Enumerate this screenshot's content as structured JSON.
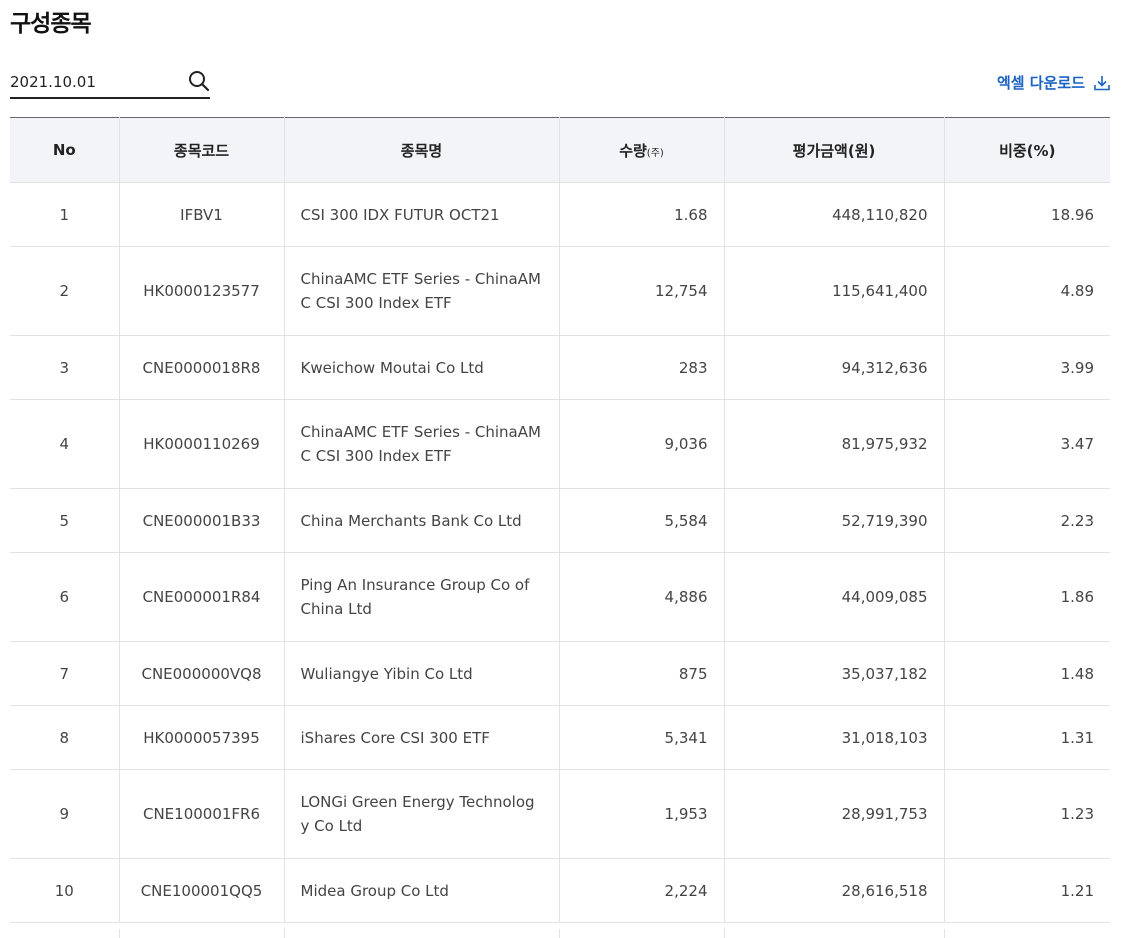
{
  "page_title": "구성종목",
  "search": {
    "date_value": "2021.10.01"
  },
  "download": {
    "label": "엑셀 다운로드"
  },
  "table": {
    "headers": {
      "no": "No",
      "code": "종목코드",
      "name": "종목명",
      "quantity": "수량",
      "quantity_unit": "(주)",
      "value": "평가금액(원)",
      "weight": "비중(%)"
    },
    "rows": [
      {
        "no": "1",
        "code": "IFBV1",
        "name": "CSI 300 IDX FUTUR OCT21",
        "quantity": "1.68",
        "value": "448,110,820",
        "weight": "18.96"
      },
      {
        "no": "2",
        "code": "HK0000123577",
        "name": "ChinaAMC ETF Series - ChinaAMC CSI 300 Index ETF",
        "quantity": "12,754",
        "value": "115,641,400",
        "weight": "4.89"
      },
      {
        "no": "3",
        "code": "CNE0000018R8",
        "name": "Kweichow Moutai Co Ltd",
        "quantity": "283",
        "value": "94,312,636",
        "weight": "3.99"
      },
      {
        "no": "4",
        "code": "HK0000110269",
        "name": "ChinaAMC ETF Series - ChinaAMC CSI 300 Index ETF",
        "quantity": "9,036",
        "value": "81,975,932",
        "weight": "3.47"
      },
      {
        "no": "5",
        "code": "CNE000001B33",
        "name": "China Merchants Bank Co Ltd",
        "quantity": "5,584",
        "value": "52,719,390",
        "weight": "2.23"
      },
      {
        "no": "6",
        "code": "CNE000001R84",
        "name": "Ping An Insurance Group Co of China Ltd",
        "quantity": "4,886",
        "value": "44,009,085",
        "weight": "1.86"
      },
      {
        "no": "7",
        "code": "CNE000000VQ8",
        "name": "Wuliangye Yibin Co Ltd",
        "quantity": "875",
        "value": "35,037,182",
        "weight": "1.48"
      },
      {
        "no": "8",
        "code": "HK0000057395",
        "name": "iShares Core CSI 300 ETF",
        "quantity": "5,341",
        "value": "31,018,103",
        "weight": "1.31"
      },
      {
        "no": "9",
        "code": "CNE100001FR6",
        "name": "LONGi Green Energy Technology Co Ltd",
        "quantity": "1,953",
        "value": "28,991,753",
        "weight": "1.23"
      },
      {
        "no": "10",
        "code": "CNE100001QQ5",
        "name": "Midea Group Co Ltd",
        "quantity": "2,224",
        "value": "28,616,518",
        "weight": "1.21"
      }
    ]
  },
  "colors": {
    "accent": "#1a62c4",
    "header_bg": "#f3f4f7",
    "border": "#e2e2e2"
  }
}
